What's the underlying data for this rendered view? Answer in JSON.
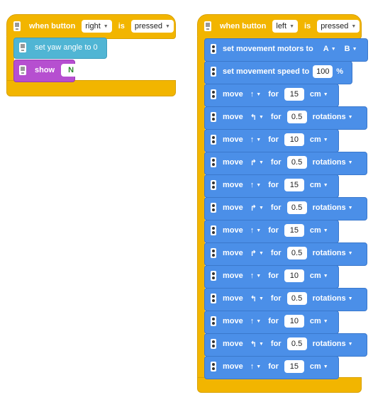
{
  "script1": {
    "hat_prefix": "when button",
    "button_value": "right",
    "is_label": "is",
    "state_value": "pressed",
    "yaw_label": "set yaw angle to 0",
    "show_label": "show",
    "show_value": "N"
  },
  "script2": {
    "hat_prefix": "when button",
    "button_value": "left",
    "is_label": "is",
    "state_value": "pressed",
    "motors_label": "set movement motors to",
    "motor_a": "A",
    "motor_b": "B",
    "speed_label": "set movement speed to",
    "speed_value": "100",
    "speed_unit": "%",
    "moves": [
      {
        "label": "move",
        "dir": "↑",
        "for": "for",
        "value": "15",
        "unit": "cm"
      },
      {
        "label": "move",
        "dir": "↰",
        "for": "for",
        "value": "0.5",
        "unit": "rotations"
      },
      {
        "label": "move",
        "dir": "↑",
        "for": "for",
        "value": "10",
        "unit": "cm"
      },
      {
        "label": "move",
        "dir": "↱",
        "for": "for",
        "value": "0.5",
        "unit": "rotations"
      },
      {
        "label": "move",
        "dir": "↑",
        "for": "for",
        "value": "15",
        "unit": "cm"
      },
      {
        "label": "move",
        "dir": "↱",
        "for": "for",
        "value": "0.5",
        "unit": "rotations"
      },
      {
        "label": "move",
        "dir": "↑",
        "for": "for",
        "value": "15",
        "unit": "cm"
      },
      {
        "label": "move",
        "dir": "↱",
        "for": "for",
        "value": "0.5",
        "unit": "rotations"
      },
      {
        "label": "move",
        "dir": "↑",
        "for": "for",
        "value": "10",
        "unit": "cm"
      },
      {
        "label": "move",
        "dir": "↰",
        "for": "for",
        "value": "0.5",
        "unit": "rotations"
      },
      {
        "label": "move",
        "dir": "↑",
        "for": "for",
        "value": "10",
        "unit": "cm"
      },
      {
        "label": "move",
        "dir": "↰",
        "for": "for",
        "value": "0.5",
        "unit": "rotations"
      },
      {
        "label": "move",
        "dir": "↑",
        "for": "for",
        "value": "15",
        "unit": "cm"
      }
    ]
  },
  "icons": {
    "hub": "hub-icon",
    "display": "display-icon",
    "motor_pair": "motor-pair-icon"
  },
  "colors": {
    "event": "#f2b500",
    "movement": "#4b8fe8",
    "sensor": "#50b5d4",
    "light": "#b64fd0"
  }
}
